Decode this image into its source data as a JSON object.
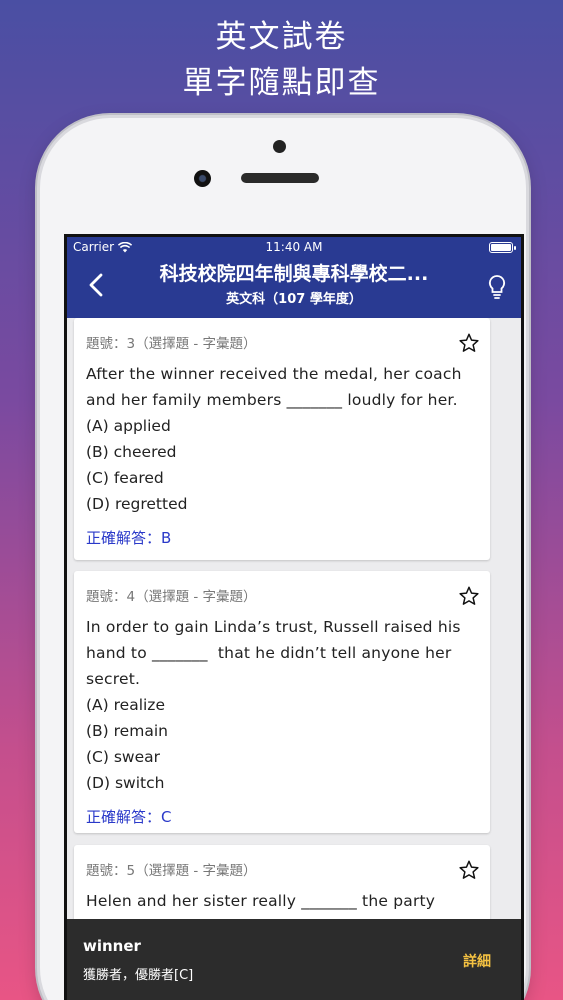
{
  "promo": {
    "line1": "英文試卷",
    "line2": "單字隨點即查"
  },
  "status_bar": {
    "carrier": "Carrier",
    "time": "11:40 AM"
  },
  "nav": {
    "title": "科技校院四年制與專科學校二...",
    "subtitle": "英文科（107 學年度）"
  },
  "questions": [
    {
      "meta": "題號：3（選擇題 - 字彙題）",
      "lines": [
        "After the winner received the medal, her coach",
        "and her family members _______ loudly for her."
      ],
      "options": [
        "(A) applied",
        "(B) cheered",
        "(C) feared",
        "(D) regretted"
      ],
      "answer": "正確解答：B"
    },
    {
      "meta": "題號：4（選擇題 - 字彙題）",
      "lines": [
        "In order to gain Linda’s trust, Russell raised his",
        "hand to _______  that he didn’t tell anyone her",
        "secret."
      ],
      "options": [
        "(A) realize",
        "(B) remain",
        "(C) swear",
        "(D) switch"
      ],
      "answer": "正確解答：C"
    },
    {
      "meta": "題號：5（選擇題 - 字彙題）",
      "lines": [
        "Helen and her sister really _______ the party"
      ],
      "options": [],
      "answer": ""
    }
  ],
  "toast": {
    "word": "winner",
    "definition": "獲勝者，優勝者[C]",
    "action": "詳細"
  }
}
